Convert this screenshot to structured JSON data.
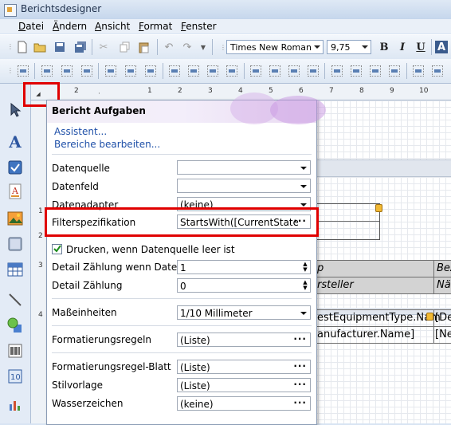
{
  "window": {
    "title": "Berichtsdesigner"
  },
  "menu": {
    "items": [
      {
        "label": "Datei",
        "mnemonic": "D",
        "rest": "atei"
      },
      {
        "label": "Ändern",
        "mnemonic": "Ä",
        "rest": "ndern"
      },
      {
        "label": "Ansicht",
        "mnemonic": "A",
        "rest": "nsicht"
      },
      {
        "label": "Format",
        "mnemonic": "F",
        "rest": "ormat"
      },
      {
        "label": "Fenster",
        "mnemonic": "F",
        "rest": "enster"
      }
    ]
  },
  "toolbar": {
    "font_name": "Times New Roman",
    "font_size": "9,75",
    "bold": "B",
    "italic": "I",
    "underline": "U",
    "font_color_letter": "A"
  },
  "ruler": {
    "h_numbers": [
      "2",
      "1",
      "2",
      "3",
      "4",
      "5",
      "6",
      "7",
      "8",
      "9",
      "10"
    ],
    "v_numbers": [
      "1",
      "2",
      "3",
      "4"
    ]
  },
  "tasks_panel": {
    "title": "Bericht Aufgaben",
    "links": [
      "Assistent...",
      "Bereiche bearbeiten..."
    ],
    "properties": {
      "datenquelle": {
        "label": "Datenquelle",
        "value": ""
      },
      "datenfeld": {
        "label": "Datenfeld",
        "value": ""
      },
      "datenadapter": {
        "label": "Datenadapter",
        "value": "(keine)"
      },
      "filterspezifikation": {
        "label": "Filterspezifikation",
        "value": "StartsWith([CurrentState.Desc"
      },
      "drucken": {
        "label": "Drucken, wenn Datenquelle leer ist",
        "checked": true
      },
      "detail_zaehlung_leer": {
        "label": "Detail Zählung wenn Daten Leer",
        "value": "1"
      },
      "detail_zaehlung": {
        "label": "Detail Zählung",
        "value": "0"
      },
      "masseinheiten": {
        "label": "Maßeinheiten",
        "value": "1/10 Millimeter"
      },
      "formatierungsregeln": {
        "label": "Formatierungsregeln",
        "value": "(Liste)"
      },
      "formatierungsregel_blatt": {
        "label": "Formatierungsregel-Blatt",
        "value": "(Liste)"
      },
      "stilvorlage": {
        "label": "Stilvorlage",
        "value": "(Liste)"
      },
      "wasserzeichen": {
        "label": "Wasserzeichen",
        "value": "(keine)"
      }
    }
  },
  "report_canvas": {
    "header_row1": [
      "p",
      "Bez"
    ],
    "header_row2": [
      "rsteller",
      "Näc"
    ],
    "data_row1": [
      "estEquipmentType.Nam",
      "[De"
    ],
    "data_row2": [
      "anufacturer.Name]",
      "[Ne"
    ]
  },
  "colors": {
    "highlight": "#e00000",
    "link": "#1f50a8"
  }
}
